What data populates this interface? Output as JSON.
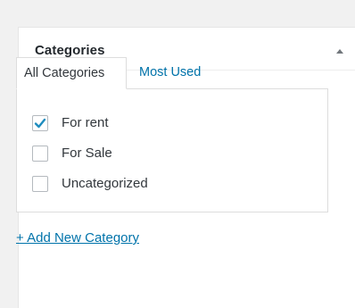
{
  "metabox": {
    "title": "Categories",
    "toggle_icon": "triangle-up-icon"
  },
  "tabs": [
    {
      "label": "All Categories",
      "active": true
    },
    {
      "label": "Most Used",
      "active": false
    }
  ],
  "categories": [
    {
      "label": "For rent",
      "checked": true
    },
    {
      "label": "For Sale",
      "checked": false
    },
    {
      "label": "Uncategorized",
      "checked": false
    }
  ],
  "add_link": {
    "label": "+ Add New Category"
  },
  "colors": {
    "link": "#0073aa",
    "check": "#1e8cbe",
    "background": "#f1f1f1"
  }
}
